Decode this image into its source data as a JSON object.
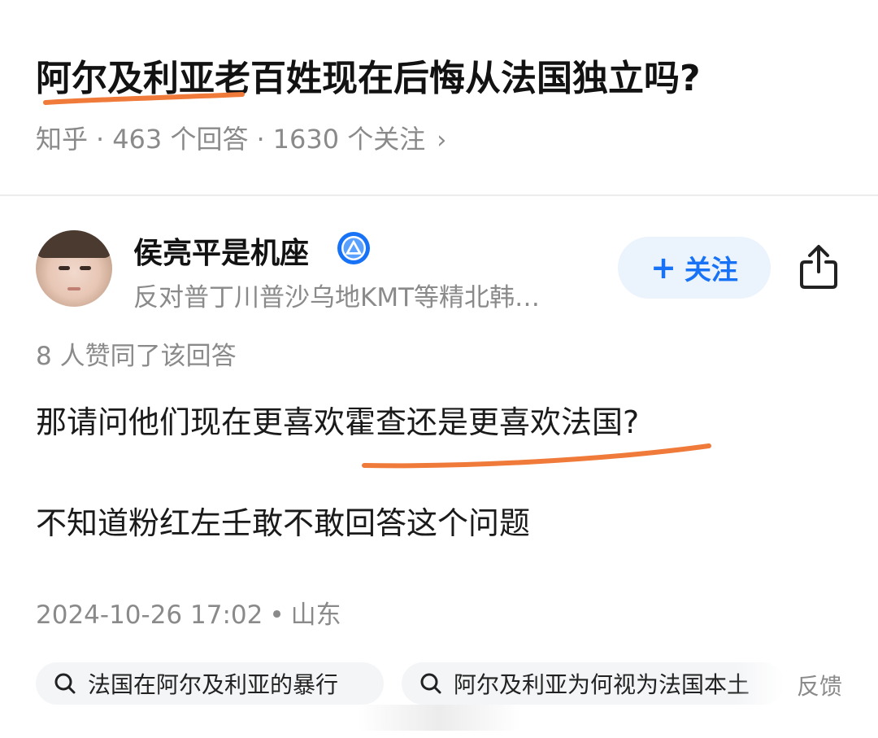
{
  "question": {
    "title": "阿尔及利亚老百姓现在后悔从法国独立吗?",
    "source": "知乎",
    "answers": "463 个回答",
    "followers": "1630 个关注",
    "chevron": "›"
  },
  "author": {
    "name": "侯亮平是机座",
    "bio": "反对普丁川普沙乌地KMT等精北韩…",
    "follow_label": "关注",
    "follow_plus": "+"
  },
  "answer": {
    "likes": "8 人赞同了该回答",
    "paragraphs": [
      "那请问他们现在更喜欢霍查还是更喜欢法国?",
      "不知道粉红左壬敢不敢回答这个问题"
    ],
    "date": "2024-10-26 17:02",
    "location": "山东"
  },
  "related_searches": [
    "法国在阿尔及利亚的暴行",
    "阿尔及利亚为何视为法国本土"
  ],
  "feedback_label": "反馈",
  "colors": {
    "accent": "#1772f6",
    "follow_bg": "#ebf3fd",
    "annotation": "#f07a3a",
    "muted": "#8a8a8a"
  },
  "icons": {
    "badge": "blue-triangle-badge-icon",
    "share": "share-icon",
    "search": "search-icon"
  }
}
